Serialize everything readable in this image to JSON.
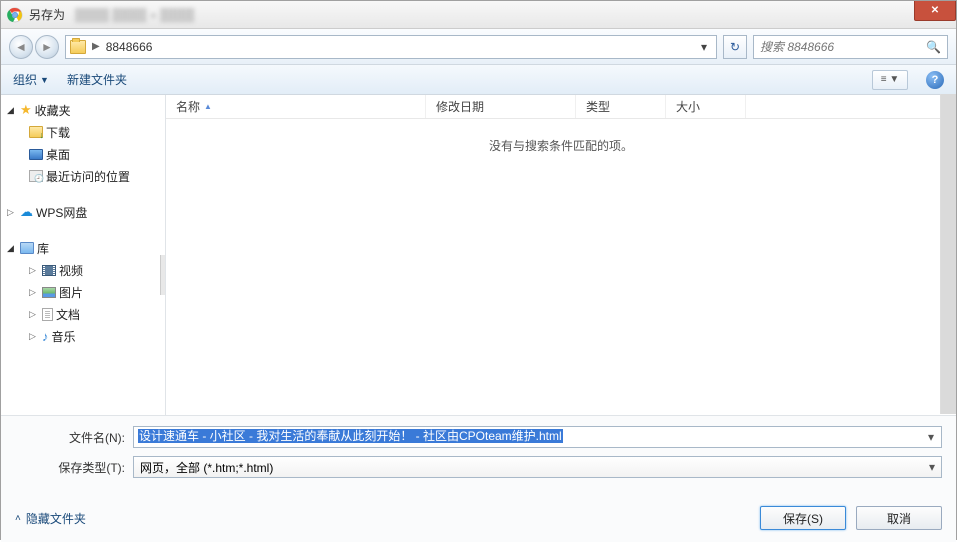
{
  "titlebar": {
    "title": "另存为"
  },
  "nav": {
    "path": "8848666",
    "search_placeholder": "搜索 8848666"
  },
  "toolbar": {
    "organize": "组织",
    "new_folder": "新建文件夹"
  },
  "sidebar": {
    "favorites": "收藏夹",
    "downloads": "下载",
    "desktop": "桌面",
    "recent": "最近访问的位置",
    "wps": "WPS网盘",
    "libraries": "库",
    "videos": "视频",
    "pictures": "图片",
    "documents": "文档",
    "music": "音乐"
  },
  "columns": {
    "name": "名称",
    "date": "修改日期",
    "type": "类型",
    "size": "大小"
  },
  "filelist": {
    "empty": "没有与搜索条件匹配的项。"
  },
  "form": {
    "filename_label": "文件名(N):",
    "filename_value": "设计速通车 - 小社区 - 我对生活的奉献从此刻开始！ - 社区由CPOteam维护.html",
    "filetype_label": "保存类型(T):",
    "filetype_value": "网页，全部 (*.htm;*.html)"
  },
  "footer": {
    "hide_folders": "隐藏文件夹",
    "save": "保存(S)",
    "cancel": "取消"
  }
}
